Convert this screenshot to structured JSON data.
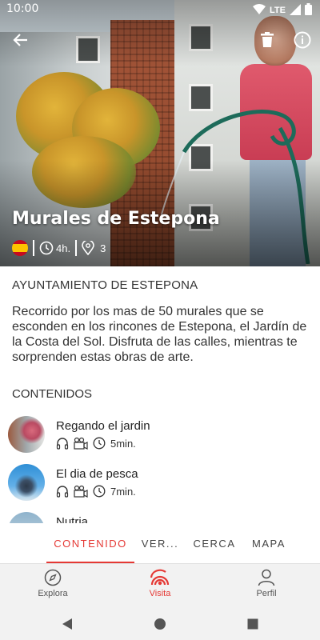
{
  "status_bar": {
    "time": "10:00",
    "network": "LTE"
  },
  "hero": {
    "title": "Murales de Estepona",
    "duration": "4h.",
    "places_count": "3",
    "flag": "spain-flag"
  },
  "organization": "AYUNTAMIENTO DE ESTEPONA",
  "description": "Recorrido por los mas de 50 murales que se esconden en los rincones de Estepona, el Jardín de la Costa del Sol. Disfruta de las calles, mientras te sorprenden estas obras de arte.",
  "contents": {
    "title": "CONTENIDOS",
    "items": [
      {
        "title": "Regando el jardin",
        "duration": "5min."
      },
      {
        "title": "El dia de pesca",
        "duration": "7min."
      },
      {
        "title": "Nutria",
        "duration": ""
      }
    ]
  },
  "tabs": [
    {
      "label": "CONTENIDO",
      "active": true
    },
    {
      "label": "VER...",
      "active": false
    },
    {
      "label": "CERCA",
      "active": false
    },
    {
      "label": "MAPA",
      "active": false
    }
  ],
  "bottom_nav": [
    {
      "label": "Explora",
      "icon": "compass-icon",
      "active": false
    },
    {
      "label": "Visita",
      "icon": "visit-icon",
      "active": true
    },
    {
      "label": "Perfil",
      "icon": "person-icon",
      "active": false
    }
  ],
  "colors": {
    "accent": "#e53935"
  }
}
